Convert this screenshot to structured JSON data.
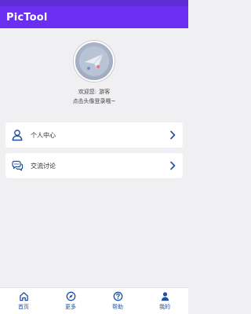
{
  "app_bar": {
    "title": "PicTool"
  },
  "profile": {
    "welcome_prefix": "欢迎您:",
    "username": "游客",
    "login_hint": "点击头像登录哦~"
  },
  "menu": [
    {
      "label": "个人中心",
      "icon": "user-icon"
    },
    {
      "label": "交流讨论",
      "icon": "chat-icon"
    }
  ],
  "bottom_nav": [
    {
      "label": "首页",
      "icon": "home-icon"
    },
    {
      "label": "更多",
      "icon": "compass-icon"
    },
    {
      "label": "帮助",
      "icon": "help-icon"
    },
    {
      "label": "我的",
      "icon": "person-icon"
    }
  ],
  "colors": {
    "primary": "#6a2ff0",
    "status_bar": "#5e2bd6",
    "accent_blue": "#1f4fa0",
    "background": "#f0f0f2"
  }
}
